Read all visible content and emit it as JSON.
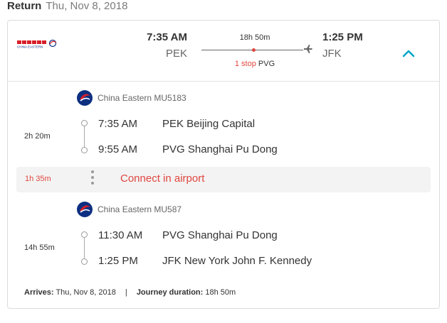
{
  "header": {
    "label": "Return",
    "date": "Thu, Nov 8, 2018"
  },
  "summary": {
    "airline_logo": "china-eastern-logo",
    "airline_logo_text": "CHINA EASTERN",
    "depart_time": "7:35 AM",
    "depart_code": "PEK",
    "arrive_time": "1:25 PM",
    "arrive_code": "JFK",
    "duration": "18h 50m",
    "stops_count": "1 stop",
    "stops_airport": "PVG",
    "toggle_icon": "chevron-up-icon"
  },
  "segments": [
    {
      "airline": "China Eastern MU5183",
      "duration": "2h 20m",
      "from": {
        "time": "7:35 AM",
        "place": "PEK Beijing Capital"
      },
      "to": {
        "time": "9:55 AM",
        "place": "PVG Shanghai Pu Dong"
      }
    },
    {
      "airline": "China Eastern MU587",
      "duration": "14h 55m",
      "from": {
        "time": "11:30 AM",
        "place": "PVG Shanghai Pu Dong"
      },
      "to": {
        "time": "1:25 PM",
        "place": "JFK New York John F. Kennedy"
      }
    }
  ],
  "connection": {
    "duration": "1h 35m",
    "text": "Connect in airport"
  },
  "footer": {
    "arrives_label": "Arrives:",
    "arrives_value": "Thu, Nov 8, 2018",
    "separator": "|",
    "journey_label": "Journey duration:",
    "journey_value": "18h 50m"
  },
  "colors": {
    "accent": "#00a6c7",
    "alert": "#e0463f",
    "brand": "#0c2f82",
    "brand_red": "#d81e28"
  }
}
